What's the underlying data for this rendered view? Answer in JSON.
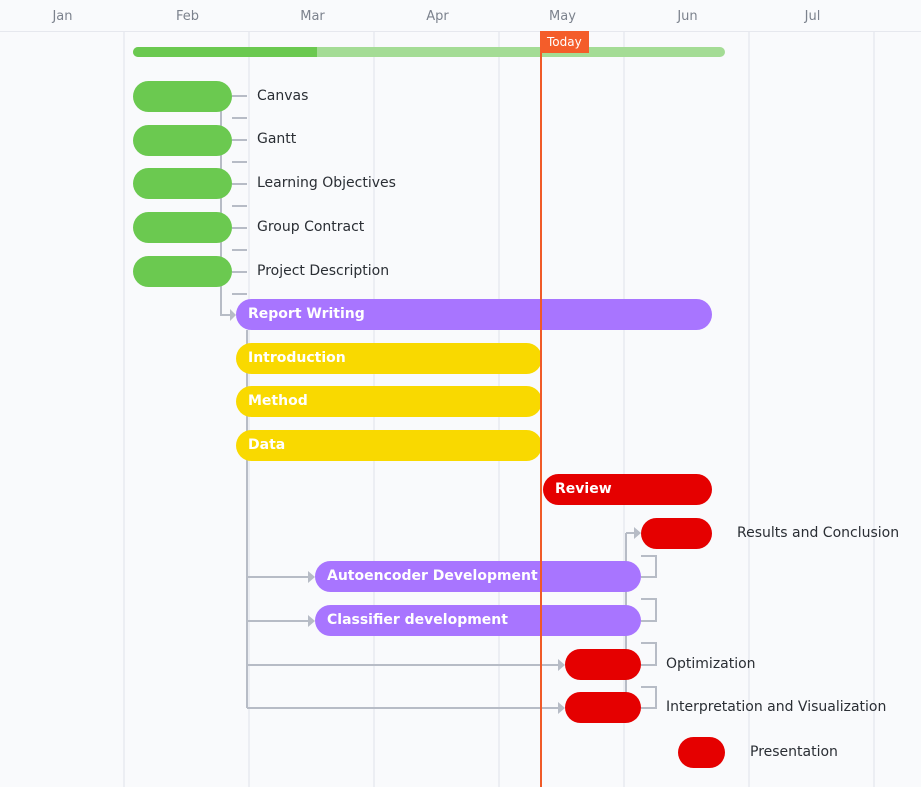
{
  "timeline": {
    "months": [
      "Jan",
      "Feb",
      "Mar",
      "Apr",
      "May",
      "Jun",
      "Jul"
    ],
    "today_label": "Today",
    "progress": 0.31
  },
  "colors": {
    "green": "#6bc950",
    "purple": "#a875ff",
    "yellow": "#f9d900",
    "red": "#e50000",
    "today": "#f05a28",
    "connector": "#b7bcc6"
  },
  "tasks": [
    {
      "name": "Canvas",
      "color": "green",
      "label_outside": true
    },
    {
      "name": "Gantt",
      "color": "green",
      "label_outside": true
    },
    {
      "name": "Learning Objectives",
      "color": "green",
      "label_outside": true
    },
    {
      "name": "Group Contract",
      "color": "green",
      "label_outside": true
    },
    {
      "name": "Project Description",
      "color": "green",
      "label_outside": true
    },
    {
      "name": "Report Writing",
      "color": "purple",
      "label_outside": false
    },
    {
      "name": "Introduction",
      "color": "yellow",
      "label_outside": false
    },
    {
      "name": "Method",
      "color": "yellow",
      "label_outside": false
    },
    {
      "name": "Data",
      "color": "yellow",
      "label_outside": false
    },
    {
      "name": "Review",
      "color": "red",
      "label_outside": false
    },
    {
      "name": "Results and Conclusion",
      "color": "red",
      "label_outside": true
    },
    {
      "name": "Autoencoder Development",
      "color": "purple",
      "label_outside": false
    },
    {
      "name": "Classifier development",
      "color": "purple",
      "label_outside": false
    },
    {
      "name": "Optimization",
      "color": "red",
      "label_outside": true
    },
    {
      "name": "Interpretation and Visualization",
      "color": "red",
      "label_outside": true
    },
    {
      "name": "Presentation",
      "color": "red",
      "label_outside": true
    }
  ]
}
